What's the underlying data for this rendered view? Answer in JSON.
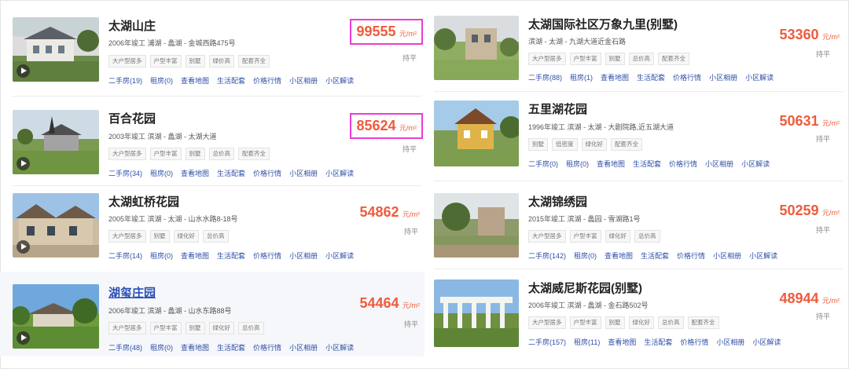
{
  "listings": [
    {
      "name": "太湖山庄",
      "meta": "2006年竣工  浦湖 - 蠡湖 - 金城西路475号",
      "tags": [
        "大户型居多",
        "户型丰富",
        "别墅",
        "绿价高",
        "配套齐全"
      ],
      "links": [
        "二手房(19)",
        "租房(0)",
        "查看地图",
        "生活配套",
        "价格行情",
        "小区相册",
        "小区解读"
      ],
      "price": "99555",
      "unit": "元/m²",
      "trend": "持平"
    },
    {
      "name": "百合花园",
      "meta": "2003年竣工  滨湖 - 蠡湖 - 太湖大道",
      "tags": [
        "大户型居多",
        "户型丰富",
        "别墅",
        "总价高",
        "配套齐全"
      ],
      "links": [
        "二手房(34)",
        "租房(0)",
        "查看地图",
        "生活配套",
        "价格行情",
        "小区相册",
        "小区解读"
      ],
      "price": "85624",
      "unit": "元/m²",
      "trend": "持平"
    },
    {
      "name": "太湖虹桥花园",
      "meta": "2005年竣工  滨湖 - 太湖 - 山水水路8-18号",
      "tags": [
        "大户型居多",
        "别墅",
        "绿化好",
        "总价高"
      ],
      "links": [
        "二手房(14)",
        "租房(0)",
        "查看地图",
        "生活配套",
        "价格行情",
        "小区相册",
        "小区解读"
      ],
      "price": "54862",
      "unit": "元/m²",
      "trend": "持平"
    },
    {
      "name": "湖玺庄园",
      "meta": "2006年竣工  滨湖 - 蠡湖 - 山水东路88号",
      "tags": [
        "大户型居多",
        "户型丰富",
        "别墅",
        "绿化好",
        "总价高"
      ],
      "links": [
        "二手房(48)",
        "租房(0)",
        "查看地图",
        "生活配套",
        "价格行情",
        "小区相册",
        "小区解读"
      ],
      "price": "54464",
      "unit": "元/m²",
      "trend": "持平"
    },
    {
      "name": "太湖国际社区万象九里(别墅)",
      "meta": "滨湖 - 太湖 - 九湖大道近金石路",
      "tags": [
        "大户型居多",
        "户型丰富",
        "别墅",
        "总价高",
        "配套齐全"
      ],
      "links": [
        "二手房(88)",
        "租房(1)",
        "查看地图",
        "生活配套",
        "价格行情",
        "小区相册",
        "小区解读"
      ],
      "price": "53360",
      "unit": "元/m²",
      "trend": "持平"
    },
    {
      "name": "五里湖花园",
      "meta": "1996年竣工  滨湖 - 太湖 - 大剧院路,近五湖大道",
      "tags": [
        "别墅",
        "低密度",
        "绿化好",
        "配套齐全"
      ],
      "links": [
        "二手房(0)",
        "租房(0)",
        "查看地图",
        "生活配套",
        "价格行情",
        "小区相册",
        "小区解读"
      ],
      "price": "50631",
      "unit": "元/m²",
      "trend": "持平"
    },
    {
      "name": "太湖锦绣园",
      "meta": "2015年竣工  滨湖 - 蠡园 - 雪湖路1号",
      "tags": [
        "大户型居多",
        "户型丰富",
        "绿化好",
        "总价高"
      ],
      "links": [
        "二手房(142)",
        "租房(0)",
        "查看地图",
        "生活配套",
        "价格行情",
        "小区相册",
        "小区解读"
      ],
      "price": "50259",
      "unit": "元/m²",
      "trend": "持平"
    },
    {
      "name": "太湖威尼斯花园(别墅)",
      "meta": "2006年竣工  滨湖 - 蠡湖 - 金石路502号",
      "tags": [
        "大户型居多",
        "户型丰富",
        "别墅",
        "绿化好",
        "总价高",
        "配套齐全"
      ],
      "links": [
        "二手房(157)",
        "租房(11)",
        "查看地图",
        "生活配套",
        "价格行情",
        "小区相册",
        "小区解读"
      ],
      "price": "48944",
      "unit": "元/m²",
      "trend": "持平"
    }
  ]
}
